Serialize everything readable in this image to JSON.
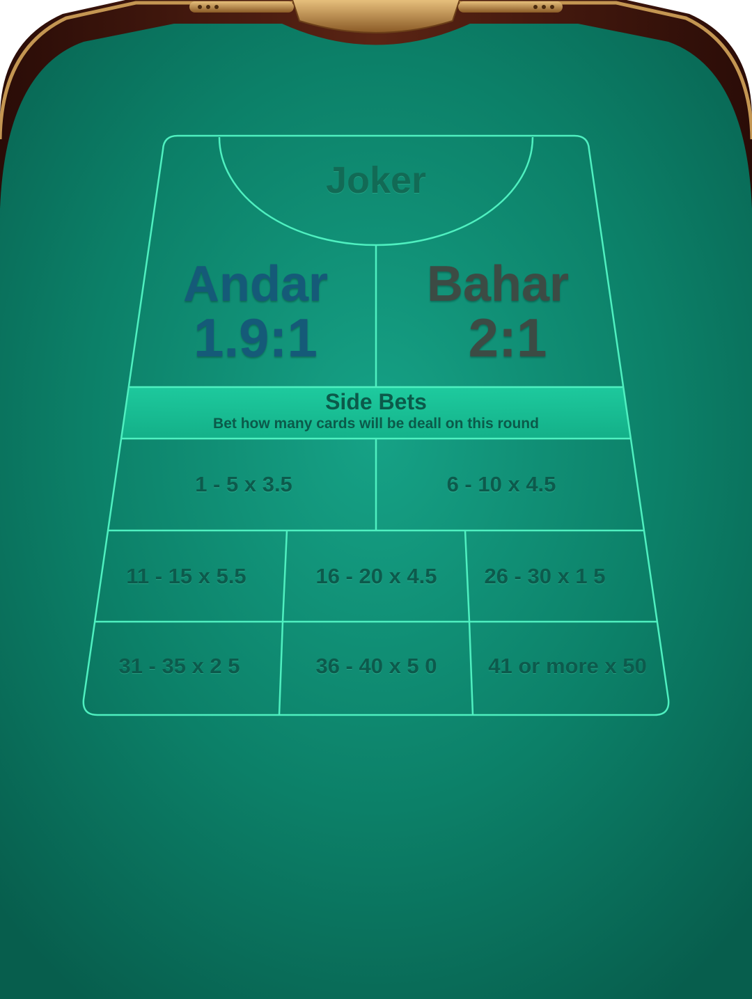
{
  "zones": {
    "joker": "Joker",
    "andar": {
      "label": "Andar",
      "payout": "1.9:1"
    },
    "bahar": {
      "label": "Bahar",
      "payout": "2:1"
    }
  },
  "side_bets": {
    "title": "Side Bets",
    "subtitle": "Bet how many cards will be deall on this round",
    "rows": [
      [
        "1   -   5 x 3.5",
        "6  -  10 x 4.5"
      ],
      [
        "11 - 15 x 5.5",
        "16 - 20 x 4.5",
        "26 - 30 x 1 5"
      ],
      [
        "31 - 35 x 2 5",
        "36 - 40 x 5 0",
        "41 or more x 50"
      ]
    ]
  },
  "colors": {
    "felt": "#0b7a66",
    "felt_dark": "#05553f",
    "line": "#4ff0c0",
    "rail": "#4a1a10",
    "trim": "#b98b4e",
    "andar_text": "#155a78",
    "bahar_text": "#3c4b44",
    "odds_text": "#0d5a4c"
  }
}
